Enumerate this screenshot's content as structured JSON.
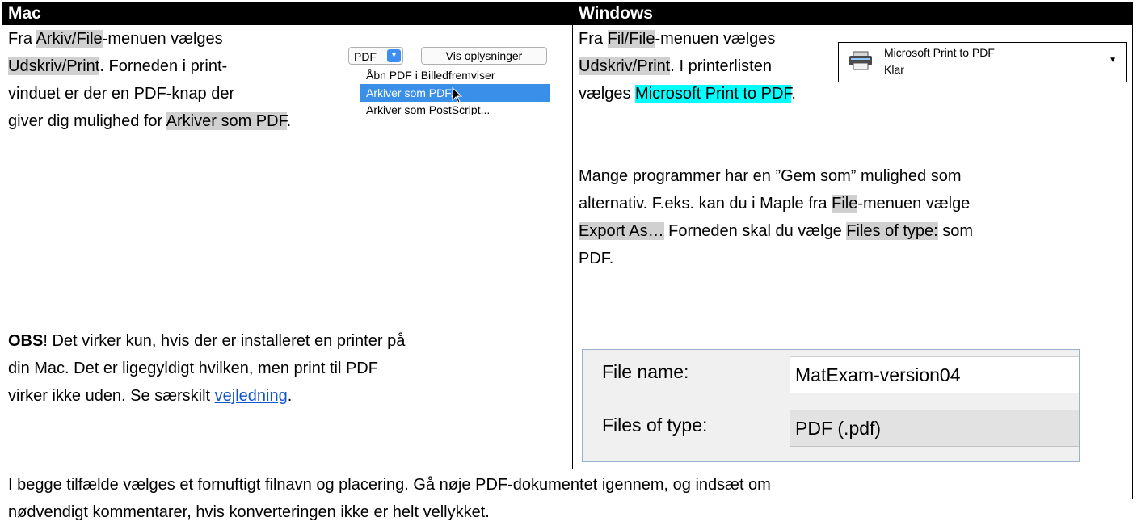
{
  "header": {
    "mac": "Mac",
    "windows": "Windows"
  },
  "mac": {
    "p1": {
      "t1": "Fra ",
      "h1": "Arkiv/File",
      "t2": "-menuen vælges",
      "h2": "Udskriv/Print",
      "t3": ". Forneden i print-",
      "t4": "vinduet er der en PDF-knap der",
      "t5": "giver dig mulighed for ",
      "h3": "Arkiver som PDF",
      "t6": "."
    },
    "screenshot": {
      "pdf_button": "PDF",
      "details_button": "Vis oplysninger",
      "items": [
        "Åbn PDF i Billedfremviser",
        "Arkiver som PDF...",
        "Arkiver som PostScript..."
      ]
    },
    "obs": {
      "bold": "OBS",
      "line1": "! Det virker kun, hvis der er installeret en printer på",
      "line2": "din Mac. Det er ligegyldigt hvilken, men print til PDF",
      "line3": "virker ikke uden. Se særskilt ",
      "link": "vejledning",
      "end": "."
    }
  },
  "windows": {
    "p1": {
      "t1": "Fra ",
      "h1": "Fil/File",
      "t2": "-menuen vælges",
      "h2": "Udskriv/Print",
      "t3": ". I printerlisten",
      "t4": "vælges ",
      "h3": "Microsoft Print to PDF",
      "t5": "."
    },
    "printer": {
      "name": "Microsoft Print to PDF",
      "status": "Klar"
    },
    "p2": {
      "line1": "Mange programmer har en ”Gem som” mulighed som",
      "line2a": "alternativ. F.eks. kan du i Maple fra ",
      "h1": "File",
      "line2b": "-menuen vælge",
      "h2": "Export As…",
      "line3a": " Forneden skal du vælge ",
      "h3": "Files of type:",
      "line3b": " som",
      "line4": "PDF."
    },
    "file_dialog": {
      "name_label": "File name:",
      "name_value": "MatExam-version04",
      "type_label": "Files of type:",
      "type_value": "PDF (.pdf)"
    }
  },
  "footer": {
    "line1": "I begge tilfælde vælges et fornuftigt filnavn og placering. Gå nøje PDF-dokumentet igennem, og indsæt om",
    "line2": "nødvendigt kommentarer, hvis konverteringen ikke er helt vellykket."
  }
}
